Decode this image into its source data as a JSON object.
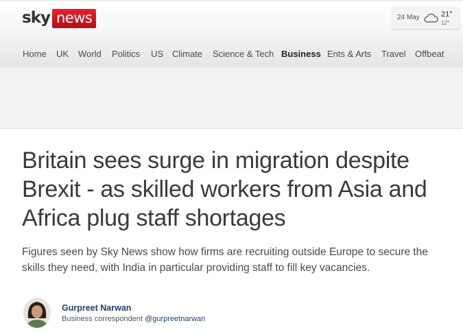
{
  "header": {
    "logo": {
      "sky": "sky",
      "news": "news"
    },
    "weather": {
      "date": "24 May",
      "icon": "cloud-icon",
      "high": "21°",
      "low": "12°"
    },
    "nav": {
      "active_index": 8,
      "items": [
        {
          "label": "Home"
        },
        {
          "label": "UK"
        },
        {
          "label": "World"
        },
        {
          "label": "Politics"
        },
        {
          "label": "US"
        },
        {
          "label": "Climate"
        },
        {
          "label": "Science & Tech"
        },
        {
          "label": "Business"
        },
        {
          "label": "Ents & Arts"
        },
        {
          "label": "Travel"
        },
        {
          "label": "Offbeat"
        }
      ]
    }
  },
  "article": {
    "headline": "Britain sees surge in migration despite Brexit - as skilled workers from Asia and Africa plug staff shortages",
    "standfirst": "Figures seen by Sky News show how firms are recruiting outside Europe to secure the skills they need, with India in particular providing staff to fill key vacancies.",
    "author": {
      "name": "Gurpreet Narwan",
      "role": "Business correspondent",
      "handle": "@gurpreetnarwan"
    }
  },
  "colors": {
    "brand_red": "#e8202a",
    "link_blue": "#1d3f6e",
    "text": "#4a4a4a"
  }
}
